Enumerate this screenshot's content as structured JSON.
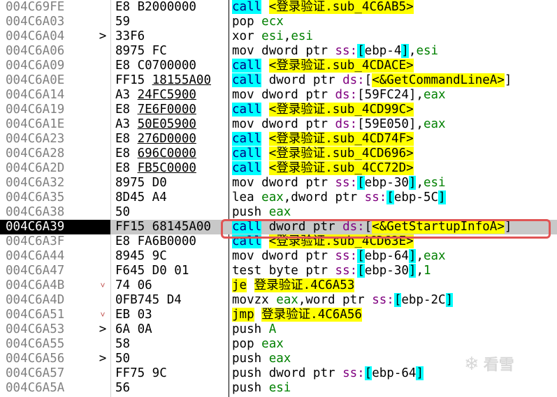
{
  "watermark": {
    "text": "看雪",
    "icon": "snowflake-icon"
  },
  "colors": {
    "call_bg": "#00ffff",
    "label_bg": "#ffff00",
    "selected_addr_bg": "#000000",
    "highlight_box": "#e05555"
  },
  "rows": [
    {
      "addr": "004C69FE",
      "arrow": "",
      "b1": "E8 B2000000",
      "b2": "",
      "op": "call",
      "args": [
        [
          "ref",
          "<登录验证.sub_4C6AB5>"
        ]
      ]
    },
    {
      "addr": "004C6A03",
      "arrow": "",
      "b1": "59",
      "b2": "",
      "op": "pop",
      "args": [
        [
          "reg",
          "ecx"
        ]
      ]
    },
    {
      "addr": "004C6A04",
      "arrow": ">",
      "b1": "33F6",
      "b2": "",
      "op": "xor",
      "args": [
        [
          "reg",
          "esi"
        ],
        [
          "txt",
          ","
        ],
        [
          "reg",
          "esi"
        ]
      ]
    },
    {
      "addr": "004C6A06",
      "arrow": "",
      "b1": "8975 FC",
      "b2": "",
      "op": "mov",
      "args": [
        [
          "txt",
          "dword ptr "
        ],
        [
          "seg",
          "ss:"
        ],
        [
          "brk",
          "["
        ],
        [
          "txt",
          "ebp-4"
        ],
        [
          "brk",
          "]"
        ],
        [
          "txt",
          ","
        ],
        [
          "reg",
          "esi"
        ]
      ]
    },
    {
      "addr": "004C6A09",
      "arrow": "",
      "b1": "E8 C0700000",
      "b2": "",
      "op": "call",
      "args": [
        [
          "ref",
          "<登录验证.sub_4CDACE>"
        ]
      ]
    },
    {
      "addr": "004C6A0E",
      "arrow": "",
      "b1": "FF15 ",
      "b2": "18155A00",
      "op": "call",
      "args": [
        [
          "txt",
          "dword ptr "
        ],
        [
          "seg",
          "ds:"
        ],
        [
          "txt",
          "["
        ],
        [
          "ref",
          "<&GetCommandLineA>"
        ],
        [
          "txt",
          "]"
        ]
      ]
    },
    {
      "addr": "004C6A14",
      "arrow": "",
      "b1": "A3 ",
      "b2": "24FC5900",
      "op": "mov",
      "args": [
        [
          "txt",
          "dword ptr "
        ],
        [
          "seg",
          "ds:"
        ],
        [
          "txt",
          "[59FC24]"
        ],
        [
          "txt",
          ","
        ],
        [
          "reg",
          "eax"
        ]
      ]
    },
    {
      "addr": "004C6A19",
      "arrow": "",
      "b1": "E8 ",
      "b2": "7E6F0000",
      "op": "call",
      "args": [
        [
          "ref",
          "<登录验证.sub_4CD99C>"
        ]
      ]
    },
    {
      "addr": "004C6A1E",
      "arrow": "",
      "b1": "A3 ",
      "b2": "50E05900",
      "op": "mov",
      "args": [
        [
          "txt",
          "dword ptr "
        ],
        [
          "seg",
          "ds:"
        ],
        [
          "txt",
          "[59E050]"
        ],
        [
          "txt",
          ","
        ],
        [
          "reg",
          "eax"
        ]
      ]
    },
    {
      "addr": "004C6A23",
      "arrow": "",
      "b1": "E8 ",
      "b2": "276D0000",
      "op": "call",
      "args": [
        [
          "ref",
          "<登录验证.sub_4CD74F>"
        ]
      ]
    },
    {
      "addr": "004C6A28",
      "arrow": "",
      "b1": "E8 ",
      "b2": "696C0000",
      "op": "call",
      "args": [
        [
          "ref",
          "<登录验证.sub_4CD696>"
        ]
      ]
    },
    {
      "addr": "004C6A2D",
      "arrow": "",
      "b1": "E8 ",
      "b2": "FB5C0000",
      "op": "call",
      "args": [
        [
          "ref",
          "<登录验证.sub_4CC72D>"
        ]
      ]
    },
    {
      "addr": "004C6A32",
      "arrow": "",
      "b1": "8975 D0",
      "b2": "",
      "op": "mov",
      "args": [
        [
          "txt",
          "dword ptr "
        ],
        [
          "seg",
          "ss:"
        ],
        [
          "brk",
          "["
        ],
        [
          "txt",
          "ebp-30"
        ],
        [
          "brk",
          "]"
        ],
        [
          "txt",
          ","
        ],
        [
          "reg",
          "esi"
        ]
      ]
    },
    {
      "addr": "004C6A35",
      "arrow": "",
      "b1": "8D45 A4",
      "b2": "",
      "op": "lea",
      "args": [
        [
          "reg",
          "eax"
        ],
        [
          "txt",
          ",dword ptr "
        ],
        [
          "seg",
          "ss:"
        ],
        [
          "brk",
          "["
        ],
        [
          "txt",
          "ebp-5C"
        ],
        [
          "brk",
          "]"
        ]
      ]
    },
    {
      "addr": "004C6A38",
      "arrow": "",
      "b1": "50",
      "b2": "",
      "op": "push",
      "args": [
        [
          "reg",
          "eax"
        ]
      ]
    },
    {
      "addr": "004C6A39",
      "arrow": "",
      "b1": "FF15 68145A00",
      "b2": "",
      "op": "call",
      "sel": true,
      "args": [
        [
          "txt",
          "dword ptr "
        ],
        [
          "seg",
          "ds:"
        ],
        [
          "txt",
          "["
        ],
        [
          "ref",
          "<&GetStartupInfoA>"
        ],
        [
          "txt",
          "]"
        ]
      ]
    },
    {
      "addr": "004C6A3F",
      "arrow": "",
      "b1": "E8 FA6B0000",
      "b2": "",
      "op": "call",
      "args": [
        [
          "ref",
          "<登录验证.sub_4CD63E>"
        ]
      ]
    },
    {
      "addr": "004C6A44",
      "arrow": "",
      "b1": "8945 9C",
      "b2": "",
      "op": "mov",
      "args": [
        [
          "txt",
          "dword ptr "
        ],
        [
          "seg",
          "ss:"
        ],
        [
          "brk",
          "["
        ],
        [
          "txt",
          "ebp-64"
        ],
        [
          "brk",
          "]"
        ],
        [
          "txt",
          ","
        ],
        [
          "reg",
          "eax"
        ]
      ]
    },
    {
      "addr": "004C6A47",
      "arrow": "",
      "b1": "F645 D0 01",
      "b2": "",
      "op": "test",
      "args": [
        [
          "txt",
          "byte ptr "
        ],
        [
          "seg",
          "ss:"
        ],
        [
          "brk",
          "["
        ],
        [
          "txt",
          "ebp-30"
        ],
        [
          "brk",
          "]"
        ],
        [
          "txt",
          ","
        ],
        [
          "num",
          "1"
        ]
      ]
    },
    {
      "addr": "004C6A4B",
      "arrow": "˅",
      "b1": "74 06",
      "b2": "",
      "op": "je",
      "args": [
        [
          "ref",
          "登录验证.4C6A53"
        ]
      ]
    },
    {
      "addr": "004C6A4D",
      "arrow": "",
      "b1": "0FB745 D4",
      "b2": "",
      "op": "movzx",
      "args": [
        [
          "reg",
          "eax"
        ],
        [
          "txt",
          ",word ptr "
        ],
        [
          "seg",
          "ss:"
        ],
        [
          "brk",
          "["
        ],
        [
          "txt",
          "ebp-2C"
        ],
        [
          "brk",
          "]"
        ]
      ]
    },
    {
      "addr": "004C6A51",
      "arrow": "˅",
      "b1": "EB 03",
      "b2": "",
      "op": "jmp",
      "args": [
        [
          "ref",
          "登录验证.4C6A56"
        ]
      ]
    },
    {
      "addr": "004C6A53",
      "arrow": ">",
      "b1": "6A 0A",
      "b2": "",
      "op": "push",
      "args": [
        [
          "num",
          "A"
        ]
      ]
    },
    {
      "addr": "004C6A55",
      "arrow": "",
      "b1": "58",
      "b2": "",
      "op": "pop",
      "args": [
        [
          "reg",
          "eax"
        ]
      ]
    },
    {
      "addr": "004C6A56",
      "arrow": ">",
      "b1": "50",
      "b2": "",
      "op": "push",
      "args": [
        [
          "reg",
          "eax"
        ]
      ]
    },
    {
      "addr": "004C6A57",
      "arrow": "",
      "b1": "FF75 9C",
      "b2": "",
      "op": "push",
      "args": [
        [
          "txt",
          "dword ptr "
        ],
        [
          "seg",
          "ss:"
        ],
        [
          "brk",
          "["
        ],
        [
          "txt",
          "ebp-64"
        ],
        [
          "brk",
          "]"
        ]
      ]
    },
    {
      "addr": "004C6A5A",
      "arrow": "",
      "b1": "56",
      "b2": "",
      "op": "push",
      "args": [
        [
          "reg",
          "esi"
        ]
      ]
    }
  ]
}
